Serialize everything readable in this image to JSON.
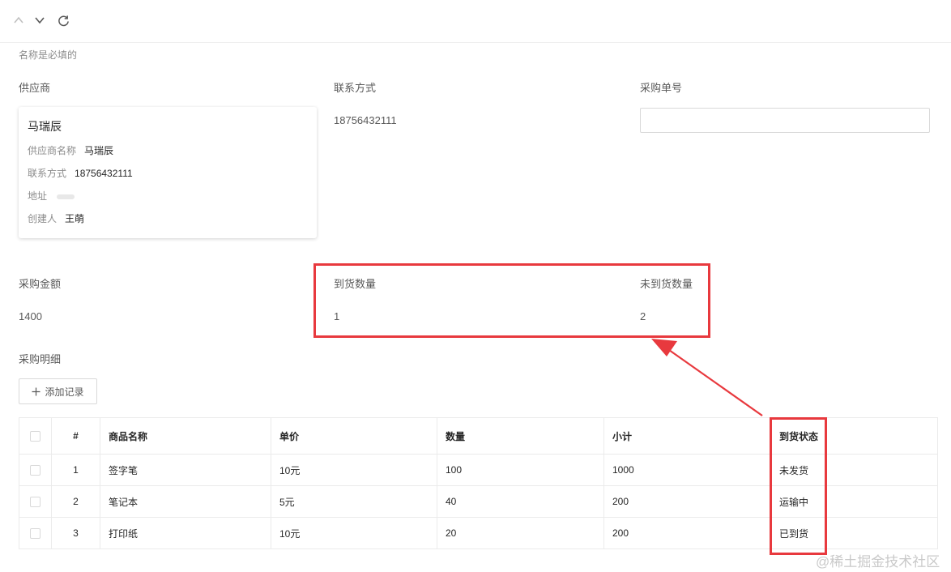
{
  "toolbar": {
    "up_icon": "chevron-up-icon",
    "down_icon": "chevron-down-icon",
    "refresh_icon": "refresh-icon"
  },
  "form": {
    "hint": "名称是必填的",
    "supplier": {
      "label": "供应商",
      "card": {
        "title": "马瑞辰",
        "name_key": "供应商名称",
        "name_value": "马瑞辰",
        "contact_key": "联系方式",
        "contact_value": "18756432111",
        "address_key": "地址",
        "creator_key": "创建人",
        "creator_value": "王萌"
      }
    },
    "contact": {
      "label": "联系方式",
      "value": "18756432111"
    },
    "order_no": {
      "label": "采购单号",
      "value": ""
    },
    "amount": {
      "label": "采购金额",
      "value": "1400"
    },
    "arrived_qty": {
      "label": "到货数量",
      "value": "1"
    },
    "pending_qty": {
      "label": "未到货数量",
      "value": "2"
    },
    "detail": {
      "label": "采购明细",
      "add_button": "添加记录"
    }
  },
  "table": {
    "headers": [
      "#",
      "商品名称",
      "单价",
      "数量",
      "小计",
      "到货状态"
    ],
    "rows": [
      {
        "index": "1",
        "name": "签字笔",
        "price": "10元",
        "qty": "100",
        "subtotal": "1000",
        "status": "未发货"
      },
      {
        "index": "2",
        "name": "笔记本",
        "price": "5元",
        "qty": "40",
        "subtotal": "200",
        "status": "运输中"
      },
      {
        "index": "3",
        "name": "打印纸",
        "price": "10元",
        "qty": "20",
        "subtotal": "200",
        "status": "已到货"
      }
    ]
  },
  "colors": {
    "annotation": "#e8393e",
    "border": "#ebebeb",
    "muted_text": "#8c8c8c"
  },
  "watermark": "@稀土掘金技术社区"
}
